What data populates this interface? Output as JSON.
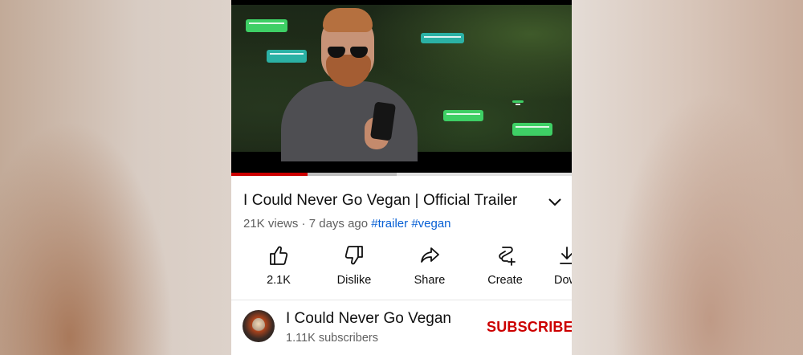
{
  "video": {
    "title": "I Could Never Go Vegan | Official Trailer",
    "views": "21K views",
    "separator": "·",
    "age": "7 days ago",
    "hashtags": [
      "#trailer",
      "#vegan"
    ],
    "progress_played": 0.225,
    "progress_buffered": 0.485
  },
  "actions": [
    {
      "label": "2.1K",
      "icon": "like-icon"
    },
    {
      "label": "Dislike",
      "icon": "dislike-icon"
    },
    {
      "label": "Share",
      "icon": "share-icon"
    },
    {
      "label": "Create",
      "icon": "create-icon"
    },
    {
      "label": "Download",
      "icon": "download-icon"
    }
  ],
  "channel": {
    "name": "I Could Never Go Vegan",
    "subscribers": "1.11K subscribers",
    "subscribe_label": "SUBSCRIBE"
  },
  "colors": {
    "accent_red": "#cc0000",
    "hashtag_blue": "#065fd4",
    "chat_green": "#3ecf65"
  }
}
